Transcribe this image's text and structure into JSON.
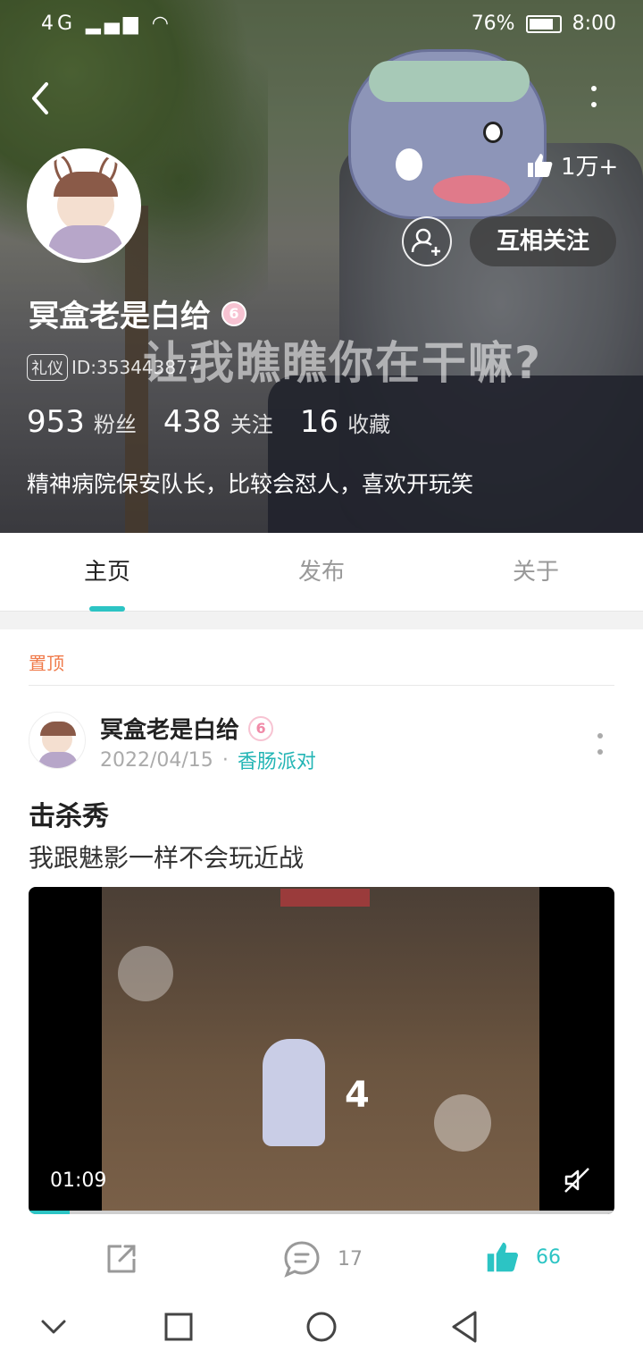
{
  "status_bar": {
    "signal": "4G",
    "battery": "76%",
    "time": "8:00"
  },
  "header": {
    "background_caption": "让我瞧瞧你在干嘛?",
    "likes": "1万+",
    "follow_label": "互相关注",
    "username": "冥盒老是白给",
    "level_badge": "6",
    "etiquette_tag": "礼仪",
    "user_id": "ID:353443877",
    "stats": [
      {
        "value": "953",
        "label": "粉丝"
      },
      {
        "value": "438",
        "label": "关注"
      },
      {
        "value": "16",
        "label": "收藏"
      }
    ],
    "bio": "精神病院保安队长，比较会怼人，喜欢开玩笑"
  },
  "tabs": [
    {
      "label": "主页",
      "active": true
    },
    {
      "label": "发布",
      "active": false
    },
    {
      "label": "关于",
      "active": false
    }
  ],
  "post": {
    "pinned_label": "置顶",
    "author": "冥盒老是白给",
    "level_badge": "6",
    "date": "2022/04/15",
    "separator": "·",
    "channel": "香肠派对",
    "title": "击杀秀",
    "text": "我跟魅影一样不会玩近战",
    "video": {
      "duration": "01:09",
      "progress": 0.07,
      "frame_text": "4"
    },
    "comments": "17",
    "likes": "66"
  },
  "colors": {
    "accent": "#2cc4c4",
    "pinned": "#f07a4a",
    "level_badge": "#f7c3d2"
  },
  "icons": [
    "back-icon",
    "more-icon",
    "thumbs-up-icon",
    "add-friend-icon",
    "share-icon",
    "comment-icon",
    "mute-icon",
    "nav-collapse-icon",
    "nav-recents-icon",
    "nav-home-icon",
    "nav-back-icon"
  ]
}
